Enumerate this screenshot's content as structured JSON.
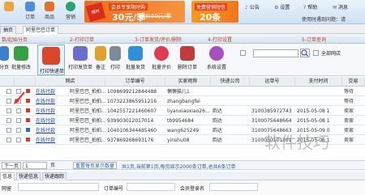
{
  "topbar": {
    "icons": [
      {
        "label": "",
        "icon": "app-icon",
        "color": "#f2a23b"
      },
      {
        "label": "订单",
        "icon": "order-icon",
        "color": "#4a8ed9"
      },
      {
        "label": "商品",
        "icon": "goods-icon",
        "color": "#e0742a"
      },
      {
        "label": "营销",
        "icon": "marketing-icon",
        "color": "#2ea36f"
      }
    ],
    "banner1": {
      "line1": "会员专享限时购",
      "price": "30元/季",
      "old_price": "原价50元/季",
      "badge": "限时"
    },
    "banner2": {
      "line1": "免费营销短信",
      "amount": "20条"
    },
    "links": [
      {
        "icon": "bell-icon",
        "label": "公告"
      },
      {
        "icon": "settings-icon",
        "label": "设置"
      },
      {
        "icon": "help-icon",
        "label": "帮助"
      },
      {
        "icon": "message-icon",
        "label": "消息"
      }
    ],
    "username": "使用时遇到问题：请"
  },
  "tabs": [
    "抽页",
    "阿里巴巴订单"
  ],
  "sections": [
    "数/起始分页",
    "2-打印订单",
    "3-订单发货/评价/删除",
    "4-打印设置",
    "5-订单查询"
  ],
  "toolbar": {
    "buttons": [
      {
        "label": "分页",
        "icon": "page-icon",
        "color": "#3b7fd0"
      },
      {
        "label": "批量修改",
        "icon": "batch-edit-icon",
        "color": "#37a043"
      },
      {
        "label": "打印快递单",
        "icon": "print-express-icon",
        "color": "#d9472b"
      },
      {
        "label": "打印发货单",
        "icon": "print-invoice-icon",
        "color": "#6a6fc9"
      },
      {
        "label": "备注",
        "icon": "remark-icon",
        "color": "#e2a22a"
      },
      {
        "label": "打印",
        "icon": "print-icon",
        "color": "#7e8a96"
      },
      {
        "label": "批量发货",
        "icon": "batch-ship-icon",
        "color": "#2f8fd8"
      },
      {
        "label": "批量评价",
        "icon": "batch-review-icon",
        "color": "#df3b4e"
      },
      {
        "label": "删除订单",
        "icon": "delete-order-icon",
        "color": "#c23a3a"
      },
      {
        "label": "系统设置",
        "icon": "system-settings-icon",
        "color": "#a54fc2"
      }
    ],
    "search_placeholder": "",
    "shop_filter": "全部网店"
  },
  "table": {
    "columns": [
      "",
      "",
      "网店",
      "订单编号",
      "买家昵称",
      "快递公司",
      "运单号",
      "支付时间",
      "交易"
    ],
    "rows": [
      {
        "flag": "red",
        "action": "在线付款",
        "shop": "阿里巴巴_拍拍...",
        "order": "1098699212844488",
        "buyer": "懒懒猫儿1",
        "express": "",
        "waybill": "",
        "paytime": "",
        "status": "等待"
      },
      {
        "flag": "red",
        "action": "在线付款",
        "shop": "阿里巴巴_拍拍...",
        "order": "1073223865951216",
        "buyer": "zhangbangfei",
        "express": "",
        "waybill": "",
        "paytime": "",
        "status": "等待"
      },
      {
        "flag": "red",
        "action": "在线付款",
        "shop": "阿里巴巴_拍拍...",
        "order": "1042557221460607",
        "buyer": "liyanxiaoxiao26...",
        "express": "韵达",
        "waybill": "3100385972743",
        "paytime": "2015-05-08 1",
        "status": "卖家"
      },
      {
        "flag": "red",
        "action": "在线付款",
        "shop": "阿里巴巴_拍拍...",
        "order": "939903012017014",
        "buyer": "tb9954684",
        "express": "韵达",
        "waybill": "3100075648664",
        "paytime": "2015-05-08 1",
        "status": "卖家"
      },
      {
        "flag": "blue",
        "action": "在线付款",
        "shop": "阿里巴巴_拍拍...",
        "order": "1040106344485460",
        "buyer": "wang625249",
        "express": "韵达",
        "waybill": "3100075648663",
        "paytime": "2015-05-09 0",
        "status": "卖家"
      },
      {
        "flag": "red",
        "action": "在线付款",
        "shop": "阿里巴巴_拍拍...",
        "order": "937869268693176",
        "buyer": "yinshu08",
        "express": "韵达",
        "waybill": "3100030101301",
        "paytime": "2015-05-06 1",
        "status": "卖家"
      }
    ]
  },
  "paging": {
    "next": "下一页",
    "last": "页",
    "current_page": "1",
    "reset_button": "重置每页显示数量",
    "summary": "共1页,当前第1页,每页显示2000条订单,总共6条订单"
  },
  "bottom": {
    "tabs": [
      "信息",
      "快递信息",
      "快递跟踪"
    ],
    "fields": [
      "网留",
      "订单编号",
      "会员登录名"
    ]
  },
  "watermark": "软件技巧"
}
